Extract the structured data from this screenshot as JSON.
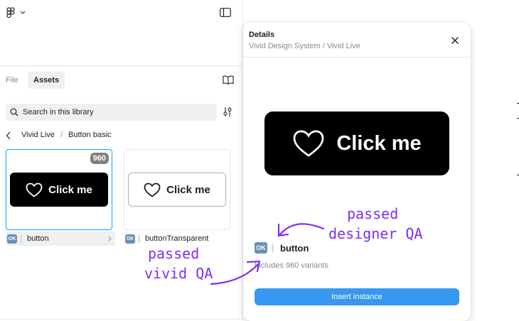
{
  "tabs": {
    "file": "File",
    "assets": "Assets"
  },
  "search": {
    "placeholder": "Search in this library"
  },
  "breadcrumb": {
    "library": "Vivid Live",
    "separator": "/",
    "page": "Button basic"
  },
  "components": [
    {
      "badge": "960",
      "preview_label": "Click me",
      "status": "OK",
      "name": "button"
    },
    {
      "preview_label": "Click me",
      "status": "OK",
      "name": "buttonTransparent"
    }
  ],
  "annotations": {
    "designer_qa": [
      "passed",
      "designer QA"
    ],
    "vivid_qa": [
      "passed",
      "vivid QA"
    ]
  },
  "details": {
    "title": "Details",
    "subtitle": "Vivid Design System / Vivid Live",
    "preview_label": "Click me",
    "status": "OK",
    "component_name": "button",
    "variants": "Includes 960 variants",
    "insert_label": "Insert instance"
  },
  "colors": {
    "accent": "#18a0fb",
    "insert_button": "#3897f0",
    "annotation": "#7b2ff7",
    "badge": "#7f7f7f"
  },
  "icons": [
    "figma-logo-icon",
    "chevron-down-icon",
    "panel-toggle-icon",
    "book-icon",
    "search-icon",
    "filter-icon",
    "chevron-left-icon",
    "heart-icon",
    "chevron-right-icon",
    "close-icon",
    "arrow-icon"
  ]
}
